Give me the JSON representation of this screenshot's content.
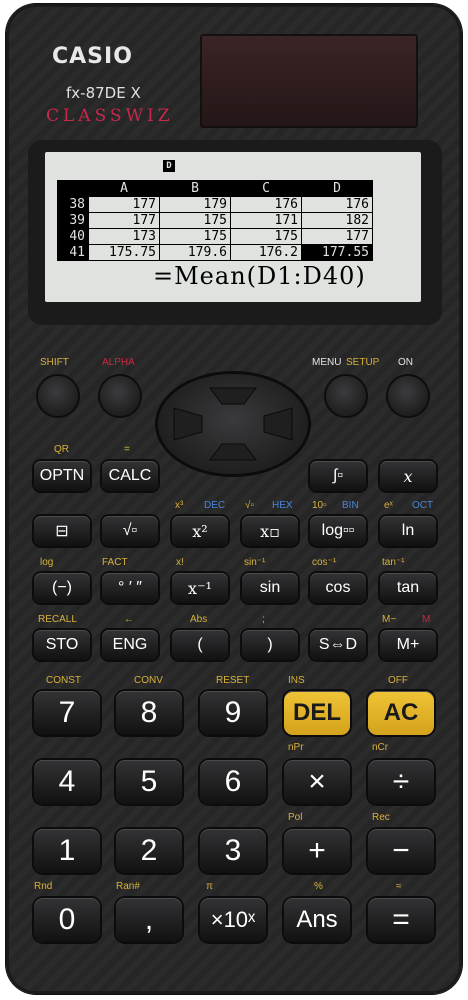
{
  "brand": "CASIO",
  "model": "fx-87DE X",
  "series": "CLASSWIZ",
  "display": {
    "cell_indicator": "D",
    "columns": [
      "A",
      "B",
      "C",
      "D"
    ],
    "rows": [
      {
        "n": "38",
        "cells": [
          "177",
          "179",
          "176",
          "176"
        ]
      },
      {
        "n": "39",
        "cells": [
          "177",
          "175",
          "171",
          "182"
        ]
      },
      {
        "n": "40",
        "cells": [
          "173",
          "175",
          "175",
          "177"
        ]
      },
      {
        "n": "41",
        "cells": [
          "175.75",
          "179.6",
          "176.2",
          "177.55"
        ]
      }
    ],
    "formula": "=Mean(D1:D40)"
  },
  "top_labels": {
    "shift": "SHIFT",
    "alpha": "ALPHA",
    "menu": "MENU",
    "setup": "SETUP",
    "on": "ON"
  },
  "row1": {
    "qr": "QR",
    "eq": "=",
    "optn": "OPTN",
    "calc": "CALC",
    "xvar": "x"
  },
  "row2": {
    "labels": [
      "x³",
      "DEC",
      "√▫",
      "HEX",
      "10▫",
      "BIN",
      "eˣ",
      "OCT"
    ],
    "keys": [
      "⊟",
      "√▫",
      "x²",
      "x▫",
      "log▫▫",
      "ln"
    ]
  },
  "row3": {
    "labels": [
      "log",
      "FACT",
      "x!",
      "sin⁻¹",
      "cos⁻¹",
      "tan⁻¹"
    ],
    "keys": [
      "(−)",
      "° ′ ″",
      "x⁻¹",
      "sin",
      "cos",
      "tan"
    ]
  },
  "row4": {
    "labels": [
      "RECALL",
      "←",
      "Abs",
      ";",
      "M−",
      "M"
    ],
    "keys": [
      "STO",
      "ENG",
      "(",
      ")",
      "S⇔D",
      "M+"
    ]
  },
  "row5": {
    "labels": [
      "CONST",
      "CONV",
      "RESET",
      "INS",
      "OFF"
    ],
    "keys": [
      "7",
      "8",
      "9",
      "DEL",
      "AC"
    ]
  },
  "row6": {
    "labels": [
      "nPr",
      "nCr"
    ],
    "keys": [
      "4",
      "5",
      "6",
      "×",
      "÷"
    ]
  },
  "row7": {
    "labels": [
      "Pol",
      "Rec"
    ],
    "keys": [
      "1",
      "2",
      "3",
      "+",
      "−"
    ]
  },
  "row8": {
    "labels": [
      "Rnd",
      "Ran#",
      "π",
      "%",
      "≈"
    ],
    "keys": [
      "0",
      ",",
      "×10ˣ",
      "Ans",
      "="
    ]
  }
}
